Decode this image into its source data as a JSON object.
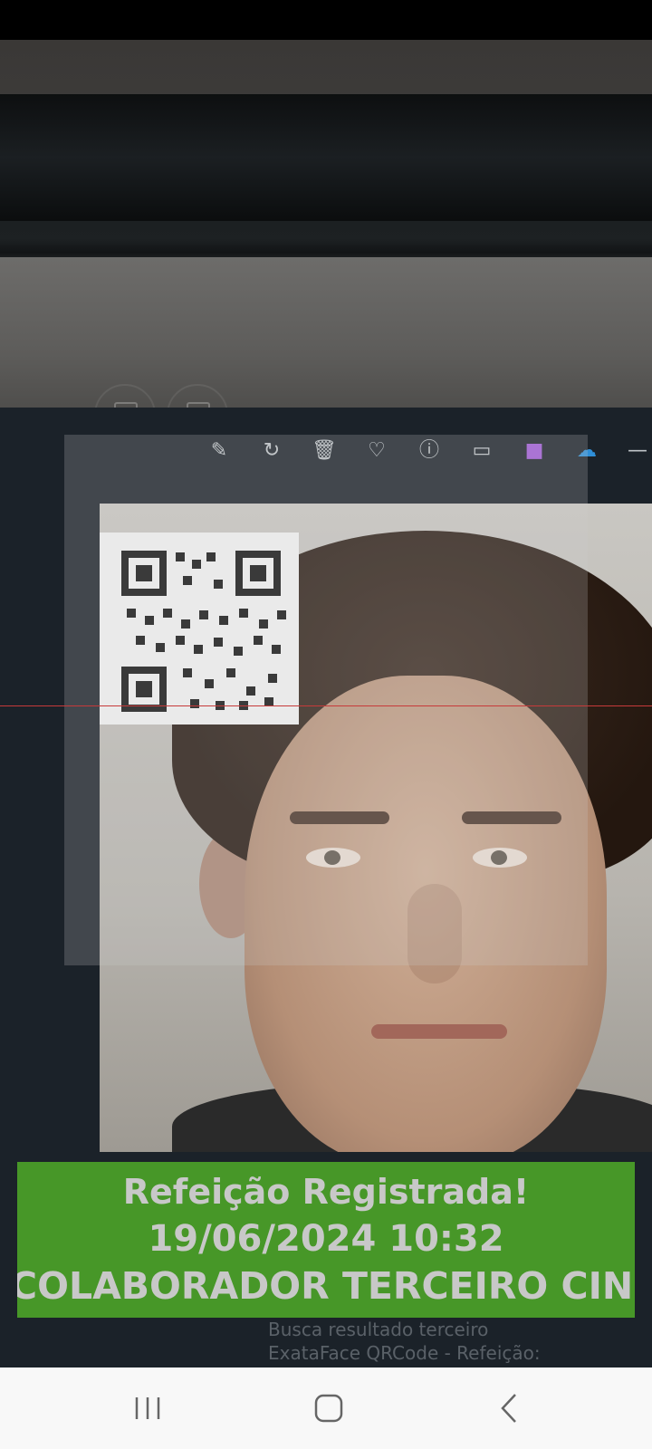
{
  "toast": {
    "title": "Refeição Registrada!",
    "datetime": "19/06/2024 10:32",
    "name": "COLABORADOR TERCEIRO CINCO"
  },
  "background_screen": {
    "line1": "Busca resultado terceiro",
    "line2": "ExataFace QRCode - Refeição:"
  },
  "toolbar_icons": [
    "edit-icon",
    "rotate-icon",
    "delete-icon",
    "heart-icon",
    "info-icon",
    "slideshow-icon",
    "album-icon",
    "cloud-icon",
    "more-icon"
  ],
  "colors": {
    "toast_bg": "#4ba228",
    "scan_line": "#c73a3a"
  }
}
